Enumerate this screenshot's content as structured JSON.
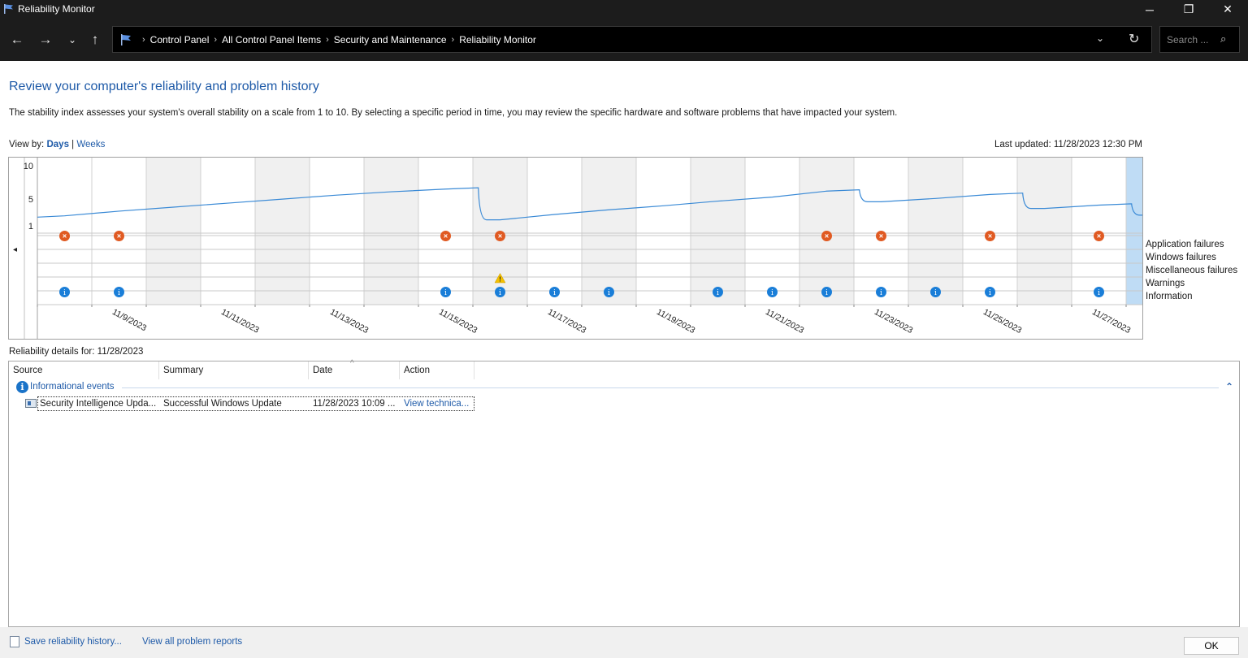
{
  "window": {
    "title": "Reliability Monitor"
  },
  "window_controls": {
    "minimize": "─",
    "maximize": "❐",
    "close": "✕"
  },
  "nav": {
    "back": "←",
    "forward": "→",
    "recent": "⌄",
    "up": "↑",
    "dropdown": "⌄",
    "refresh": "↻"
  },
  "breadcrumbs": [
    "Control Panel",
    "All Control Panel Items",
    "Security and Maintenance",
    "Reliability Monitor"
  ],
  "breadcrumb_separator": "›",
  "search": {
    "placeholder": "Search ...",
    "icon": "⌕"
  },
  "heading": "Review your computer's reliability and problem history",
  "description": "The stability index assesses your system's overall stability on a scale from 1 to 10. By selecting a specific period in time, you may review the specific hardware and software problems that have impacted your system.",
  "view_by": {
    "label": "View by:",
    "days": "Days",
    "separator": "|",
    "weeks": "Weeks"
  },
  "last_updated": "Last updated: 11/28/2023 12:30 PM",
  "chart_nav": {
    "left": "◂",
    "right": "▸"
  },
  "chart_data": {
    "type": "line",
    "y_ticks": [
      "10",
      "5",
      "1"
    ],
    "ylim": [
      1,
      10
    ],
    "x": [
      "11/8/2023",
      "11/9/2023",
      "11/10/2023",
      "11/11/2023",
      "11/12/2023",
      "11/13/2023",
      "11/14/2023",
      "11/15/2023",
      "11/16/2023",
      "11/17/2023",
      "11/18/2023",
      "11/19/2023",
      "11/20/2023",
      "11/21/2023",
      "11/22/2023",
      "11/23/2023",
      "11/24/2023",
      "11/25/2023",
      "11/26/2023",
      "11/27/2023",
      "11/28/2023"
    ],
    "x_tick_labels": [
      "11/9/2023",
      "11/11/2023",
      "11/13/2023",
      "11/15/2023",
      "11/17/2023",
      "11/19/2023",
      "11/21/2023",
      "11/23/2023",
      "11/25/2023",
      "11/27/2023"
    ],
    "stability_index": [
      2.5,
      3.2,
      3.8,
      4.4,
      5.0,
      5.6,
      6.1,
      6.5,
      1.9,
      2.7,
      3.4,
      4.0,
      4.7,
      5.3,
      6.2,
      4.6,
      5.1,
      5.7,
      3.6,
      4.1,
      2.6
    ],
    "rows": [
      "Application failures",
      "Windows failures",
      "Miscellaneous failures",
      "Warnings",
      "Information"
    ],
    "application_failures": [
      true,
      true,
      false,
      false,
      false,
      false,
      false,
      true,
      true,
      false,
      false,
      false,
      false,
      false,
      true,
      true,
      false,
      true,
      false,
      true,
      false
    ],
    "windows_failures": [
      false,
      false,
      false,
      false,
      false,
      false,
      false,
      false,
      false,
      false,
      false,
      false,
      false,
      false,
      false,
      false,
      false,
      false,
      false,
      false,
      false
    ],
    "miscellaneous_failures": [
      false,
      false,
      false,
      false,
      false,
      false,
      false,
      false,
      false,
      false,
      false,
      false,
      false,
      false,
      false,
      false,
      false,
      false,
      false,
      false,
      false
    ],
    "warnings": [
      false,
      false,
      false,
      false,
      false,
      false,
      false,
      false,
      true,
      false,
      false,
      false,
      false,
      false,
      false,
      false,
      false,
      false,
      false,
      false,
      false
    ],
    "information": [
      true,
      true,
      false,
      false,
      false,
      false,
      false,
      true,
      true,
      true,
      true,
      false,
      true,
      true,
      true,
      true,
      true,
      true,
      false,
      true,
      true
    ],
    "selected": "11/28/2023",
    "weekend_shaded": [
      "11/10/2023",
      "11/12/2023",
      "11/14/2023",
      "11/16/2023",
      "11/18/2023",
      "11/20/2023",
      "11/22/2023",
      "11/24/2023",
      "11/26/2023"
    ]
  },
  "colors": {
    "line": "#3a8ad6",
    "error": "#e05a22",
    "info": "#1a7ed8",
    "warning": "#f4c000",
    "selected": "#bfdcf5",
    "shade": "#f0f0f0",
    "link": "#1e5aa8"
  },
  "details": {
    "label": "Reliability details for: 11/28/2023",
    "columns": [
      "Source",
      "Summary",
      "Date",
      "Action"
    ],
    "sort_indicator": "^",
    "group": {
      "icon": "i",
      "label": "Informational events",
      "collapse": "⌃"
    },
    "rows": [
      {
        "source": "Security Intelligence Upda...",
        "summary": "Successful Windows Update",
        "date": "11/28/2023 10:09 ...",
        "action": "View technica..."
      }
    ]
  },
  "footer": {
    "save": "Save reliability history...",
    "view_all": "View all problem reports",
    "ok": "OK"
  }
}
